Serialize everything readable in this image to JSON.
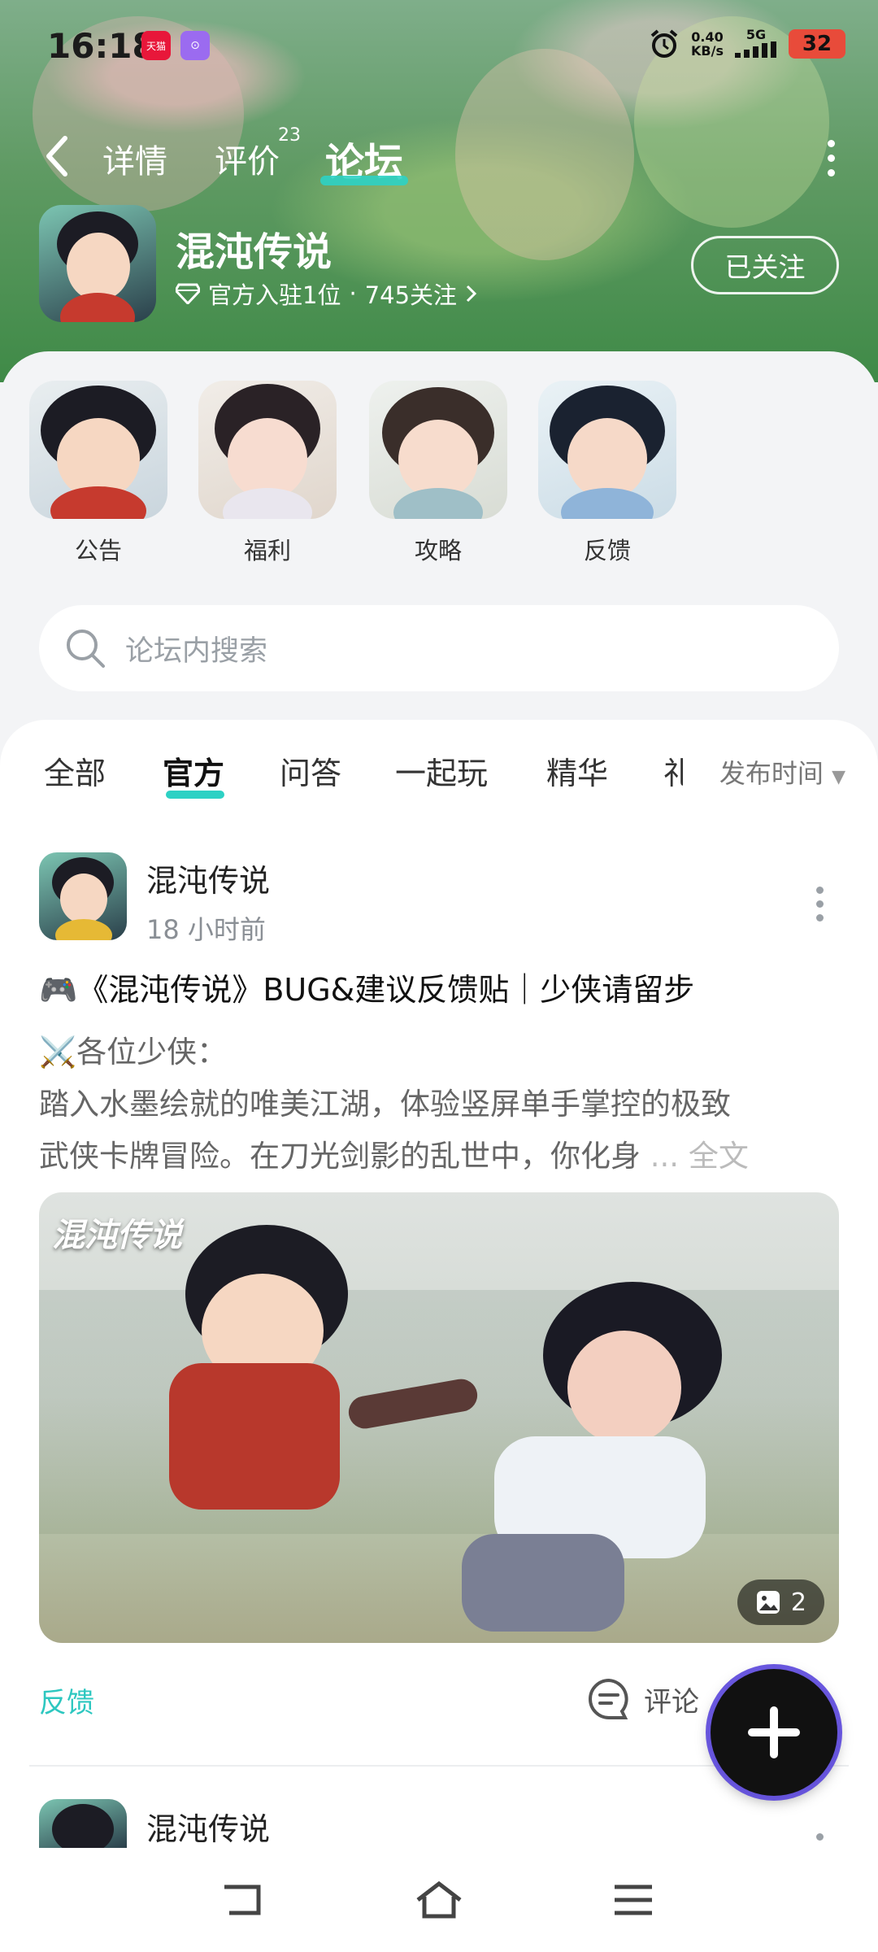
{
  "status_bar": {
    "time": "16:18",
    "badge1": "天猫",
    "net_speed": "0.40",
    "net_unit": "KB/s",
    "signal": "5G",
    "battery": "32"
  },
  "nav": {
    "tabs": [
      {
        "label": "详情"
      },
      {
        "label": "评价",
        "count": "23"
      },
      {
        "label": "论坛"
      }
    ],
    "active_tab": "论坛"
  },
  "game": {
    "title": "混沌传说",
    "meta_official": "官方入驻1位",
    "meta_sep": "·",
    "meta_followers": "745关注",
    "follow_label": "已关注"
  },
  "quick_links": [
    {
      "label": "公告"
    },
    {
      "label": "福利"
    },
    {
      "label": "攻略"
    },
    {
      "label": "反馈"
    }
  ],
  "search": {
    "placeholder": "论坛内搜索"
  },
  "feed_tabs": [
    {
      "label": "全部"
    },
    {
      "label": "官方"
    },
    {
      "label": "问答"
    },
    {
      "label": "一起玩"
    },
    {
      "label": "精华"
    },
    {
      "label": "礼"
    }
  ],
  "feed_active_tab": "官方",
  "sort_label": "发布时间",
  "posts": [
    {
      "author": "混沌传说",
      "time": "18 小时前",
      "title": "🎮《混沌传说》BUG&建议反馈贴｜少侠请留步",
      "body_line1": "⚔️各位少侠：",
      "body_line2": "踏入水墨绘就的唯美江湖，体验竖屏单手掌控的极致",
      "body_line3": "武侠卡牌冒险。在刀光剑影的乱世中，你化身",
      "ellipsis": "...",
      "full_text": "全文",
      "image_watermark": "混沌传说",
      "image_count": "2",
      "tag": "反馈",
      "comment_label": "评论"
    },
    {
      "author": "混沌传说"
    }
  ],
  "colors": {
    "accent": "#2dd1c4",
    "header_green": "#4f9a57"
  }
}
